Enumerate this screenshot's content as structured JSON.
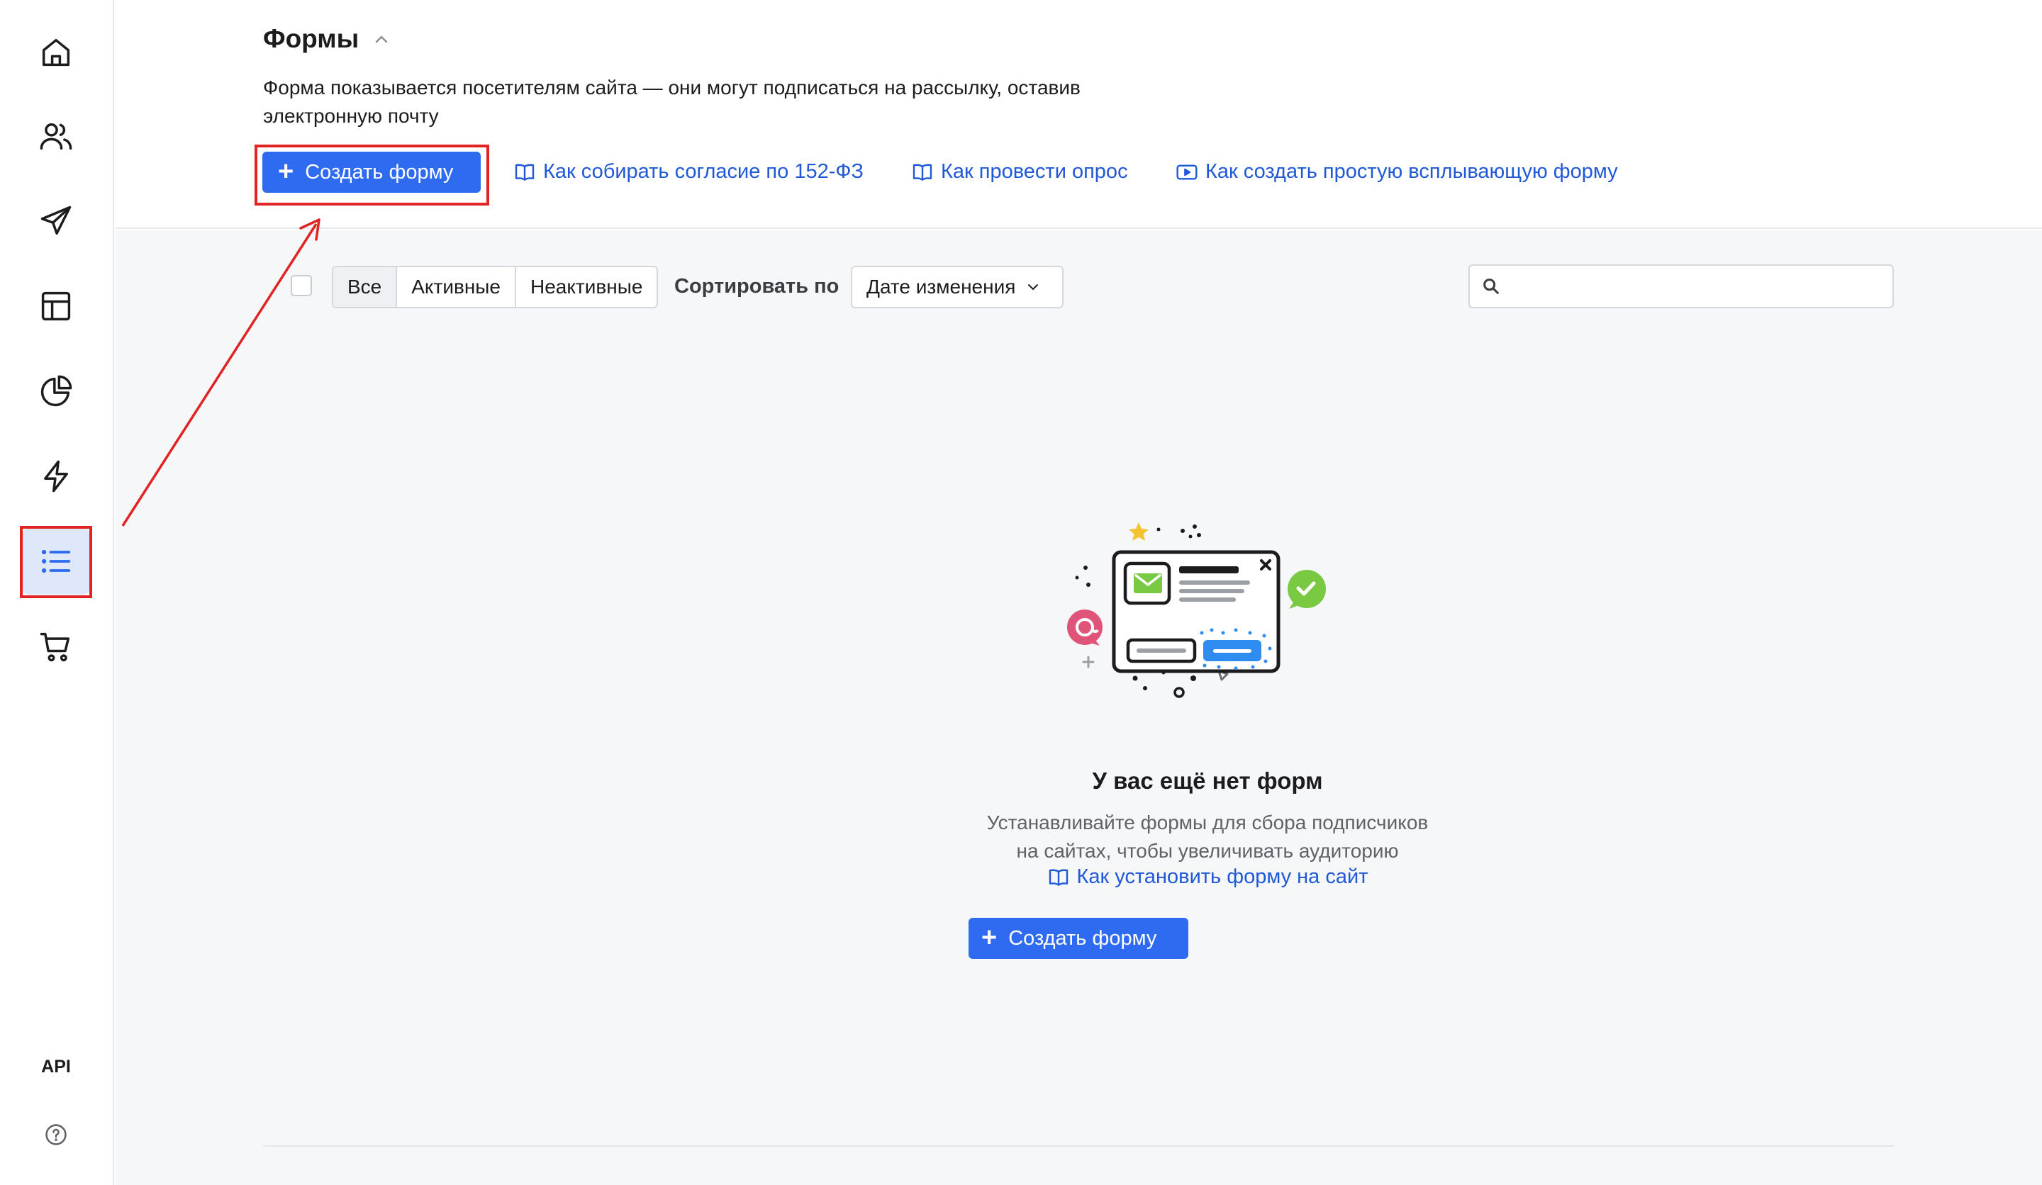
{
  "sidebar": {
    "items": [
      {
        "name": "home",
        "icon": "home-icon"
      },
      {
        "name": "contacts",
        "icon": "users-icon"
      },
      {
        "name": "campaigns",
        "icon": "send-icon"
      },
      {
        "name": "templates",
        "icon": "layout-icon"
      },
      {
        "name": "analytics",
        "icon": "pie-chart-icon"
      },
      {
        "name": "automation",
        "icon": "lightning-icon"
      },
      {
        "name": "forms",
        "icon": "list-icon",
        "active": true
      },
      {
        "name": "shop",
        "icon": "cart-icon"
      }
    ],
    "api_label": "API",
    "help_icon": "help-circle-icon"
  },
  "header": {
    "title": "Формы",
    "description": "Форма показывается посетителям сайта — они могут подписаться на рассылку, оставив электронную почту",
    "create_button": "Создать форму",
    "links": [
      {
        "label": "Как собирать согласие по 152-ФЗ",
        "icon": "book-icon"
      },
      {
        "label": "Как провести опрос",
        "icon": "book-icon"
      },
      {
        "label": "Как создать простую всплывающую форму",
        "icon": "video-icon"
      }
    ]
  },
  "toolbar": {
    "filters": [
      {
        "label": "Все",
        "active": true
      },
      {
        "label": "Активные",
        "active": false
      },
      {
        "label": "Неактивные",
        "active": false
      }
    ],
    "sort_label": "Сортировать по",
    "sort_value": "Дате изменения",
    "search_placeholder": ""
  },
  "empty_state": {
    "title": "У вас ещё нет форм",
    "description_line1": "Устанавливайте формы для сбора подписчиков",
    "description_line2": "на сайтах, чтобы увеличивать аудиторию",
    "link": "Как установить форму на сайт",
    "create_button": "Создать форму"
  },
  "colors": {
    "accent": "#2f6bf0",
    "link": "#2059d6",
    "highlight": "#e02424",
    "active_nav_bg": "#dfe8fb"
  }
}
